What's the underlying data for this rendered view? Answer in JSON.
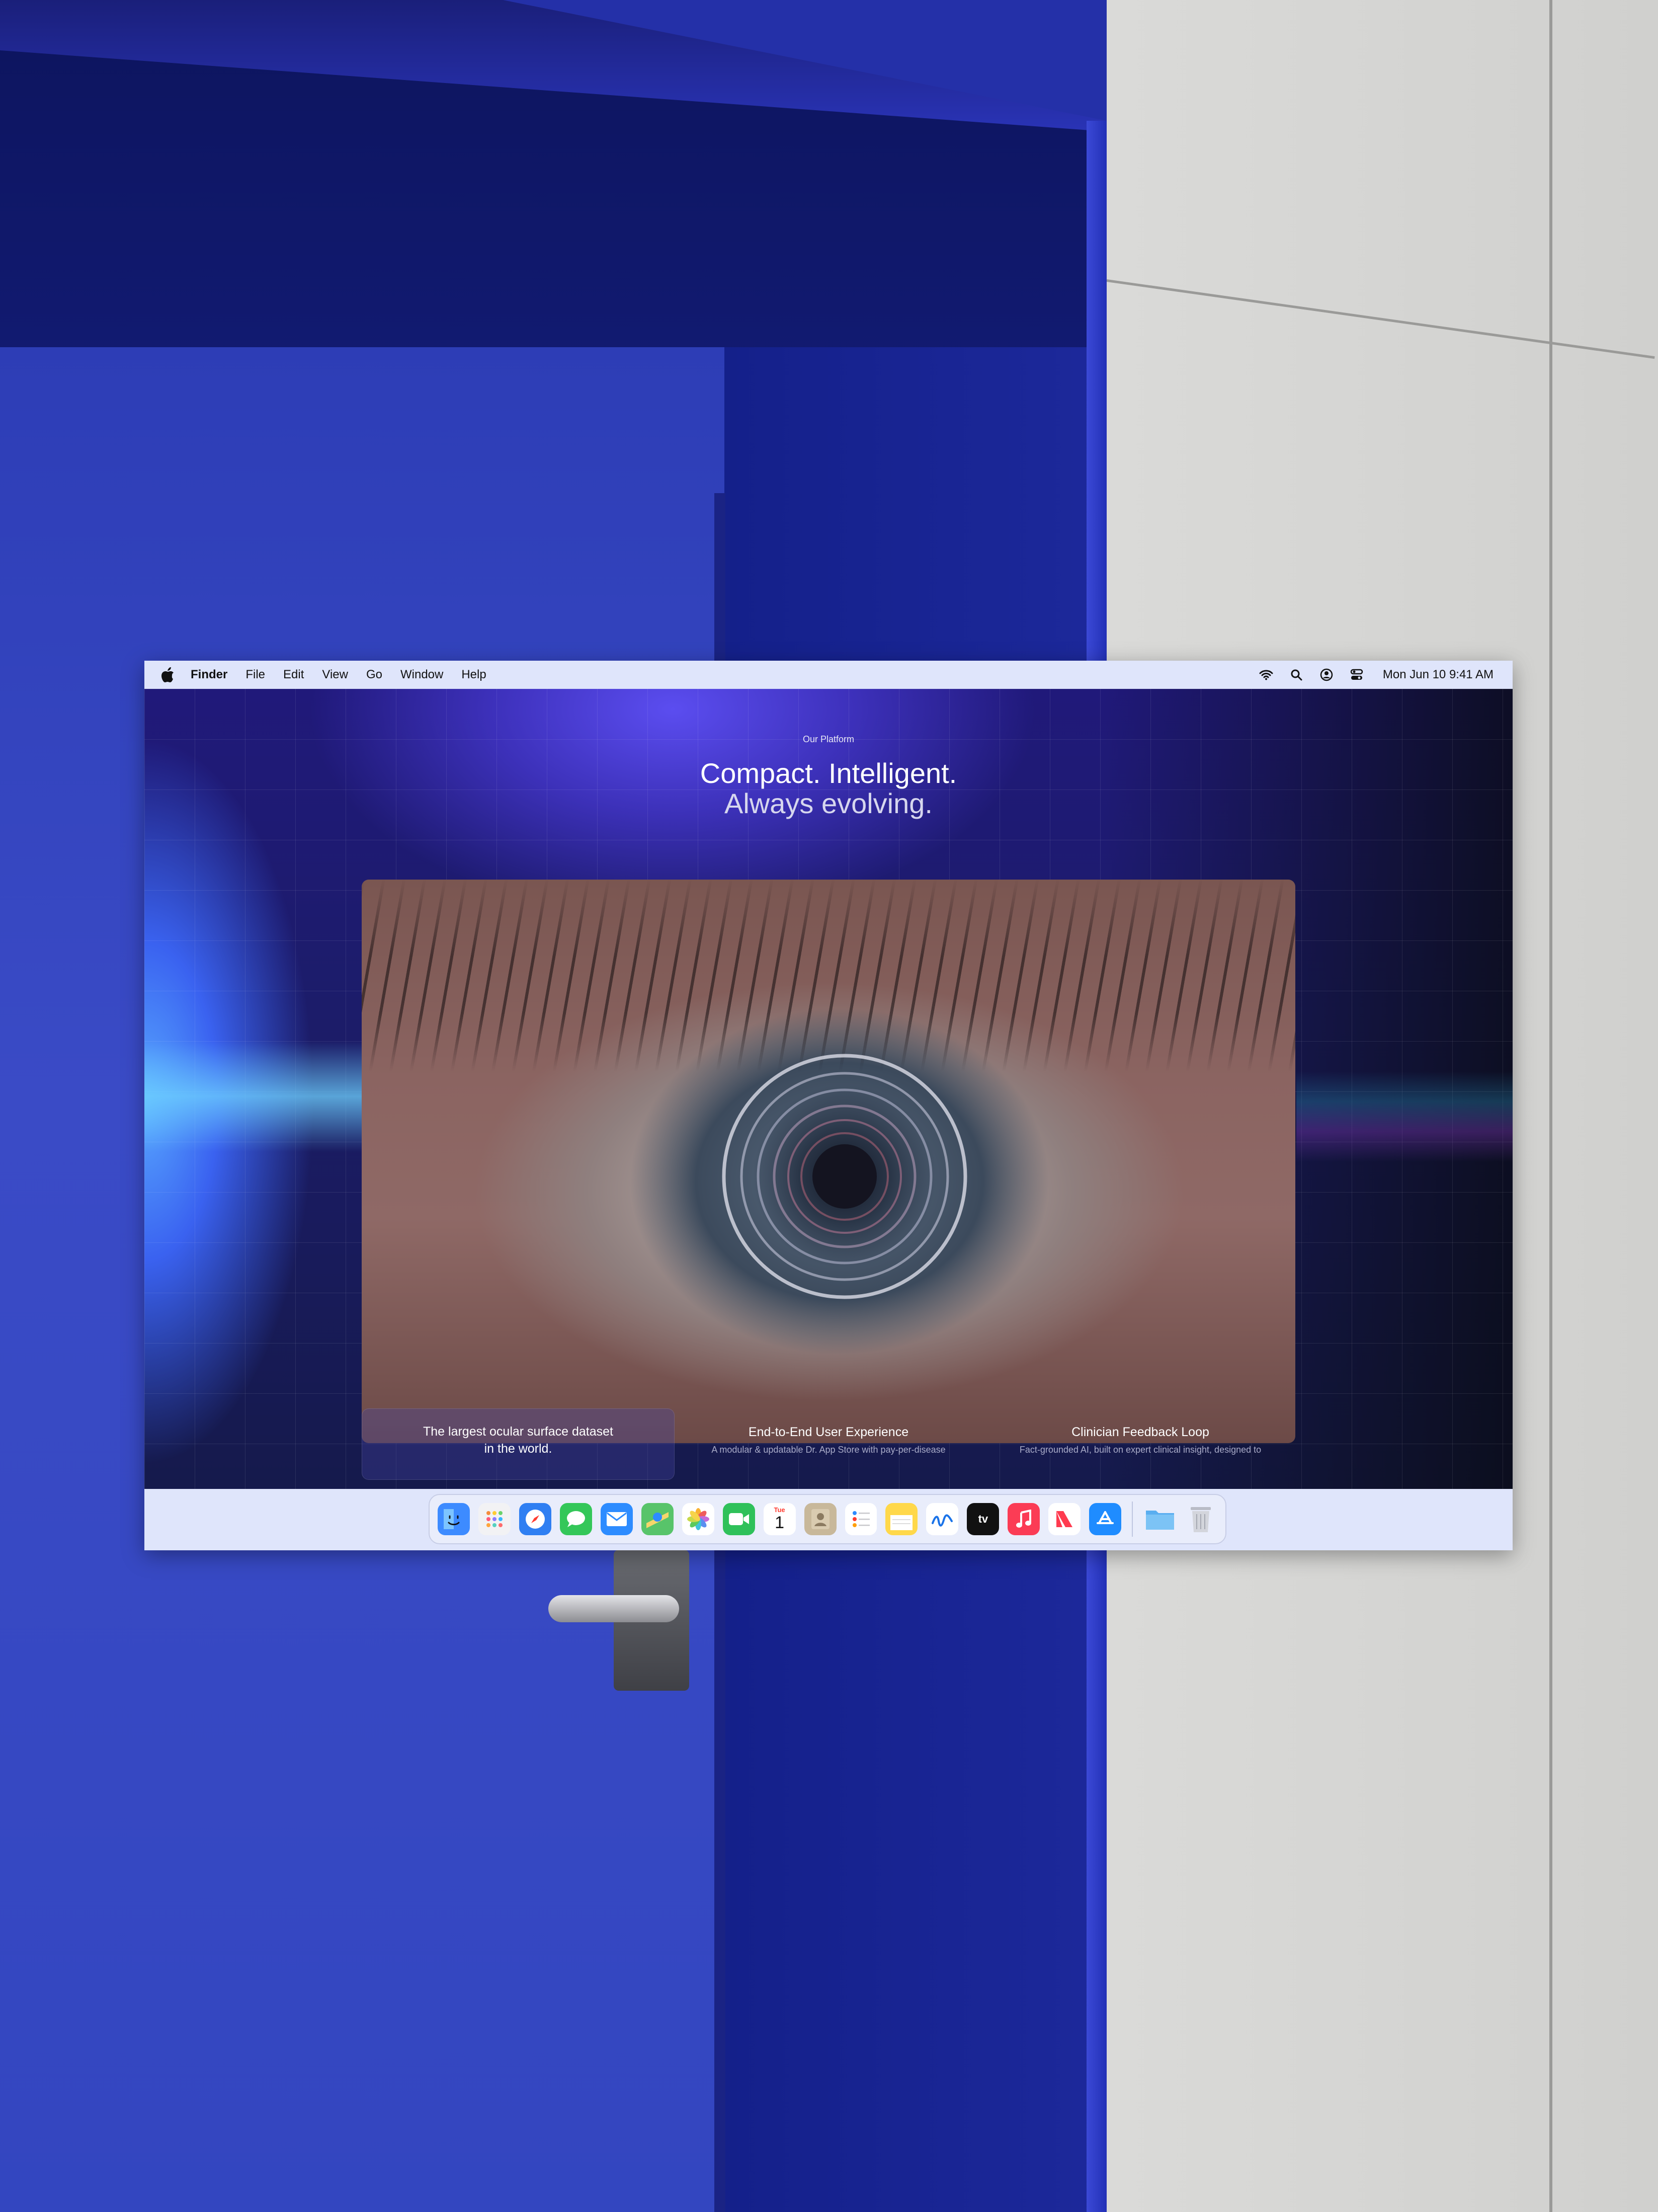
{
  "menubar": {
    "app_name": "Finder",
    "items": [
      "File",
      "Edit",
      "View",
      "Go",
      "Window",
      "Help"
    ],
    "clock": "Mon Jun 10  9:41 AM",
    "status_icons": [
      "wifi-icon",
      "search-icon",
      "user-icon",
      "control-center-icon"
    ]
  },
  "page": {
    "eyebrow": "Our Platform",
    "headline_line1": "Compact. Intelligent.",
    "headline_line2": "Always evolving.",
    "features": [
      {
        "title": "The largest ocular surface dataset in the world.",
        "desc": ""
      },
      {
        "title": "End-to-End User Experience",
        "desc": "A modular & updatable Dr. App Store with pay-per-disease"
      },
      {
        "title": "Clinician Feedback Loop",
        "desc": "Fact-grounded AI, built on expert clinical insight, designed to"
      }
    ]
  },
  "dock": {
    "apps": [
      {
        "name": "finder-icon",
        "color": "#3d8bff"
      },
      {
        "name": "launchpad-icon",
        "color": "#f2f2f4"
      },
      {
        "name": "safari-icon",
        "color": "#2f7ff2"
      },
      {
        "name": "messages-icon",
        "color": "#34c759"
      },
      {
        "name": "mail-icon",
        "color": "#2d8cff"
      },
      {
        "name": "maps-icon",
        "color": "#58c46a"
      },
      {
        "name": "photos-icon",
        "color": "#ffffff"
      },
      {
        "name": "facetime-icon",
        "color": "#2fc15a"
      },
      {
        "name": "calendar-icon",
        "color": "#ffffff"
      },
      {
        "name": "contacts-icon",
        "color": "#c8b89a"
      },
      {
        "name": "reminders-icon",
        "color": "#ffffff"
      },
      {
        "name": "notes-icon",
        "color": "#ffd84a"
      },
      {
        "name": "freeform-icon",
        "color": "#ffffff"
      },
      {
        "name": "tv-icon",
        "color": "#111111"
      },
      {
        "name": "music-icon",
        "color": "#fb3c55"
      },
      {
        "name": "news-icon",
        "color": "#ffffff"
      },
      {
        "name": "app-store-icon",
        "color": "#1f8cff"
      }
    ],
    "calendar_day": "1",
    "calendar_month": "Tue",
    "tv_label": "tv",
    "extras": [
      {
        "name": "folder-icon",
        "color": "#5aaef0"
      },
      {
        "name": "trash-icon",
        "color": "#b9bcc6"
      }
    ]
  }
}
